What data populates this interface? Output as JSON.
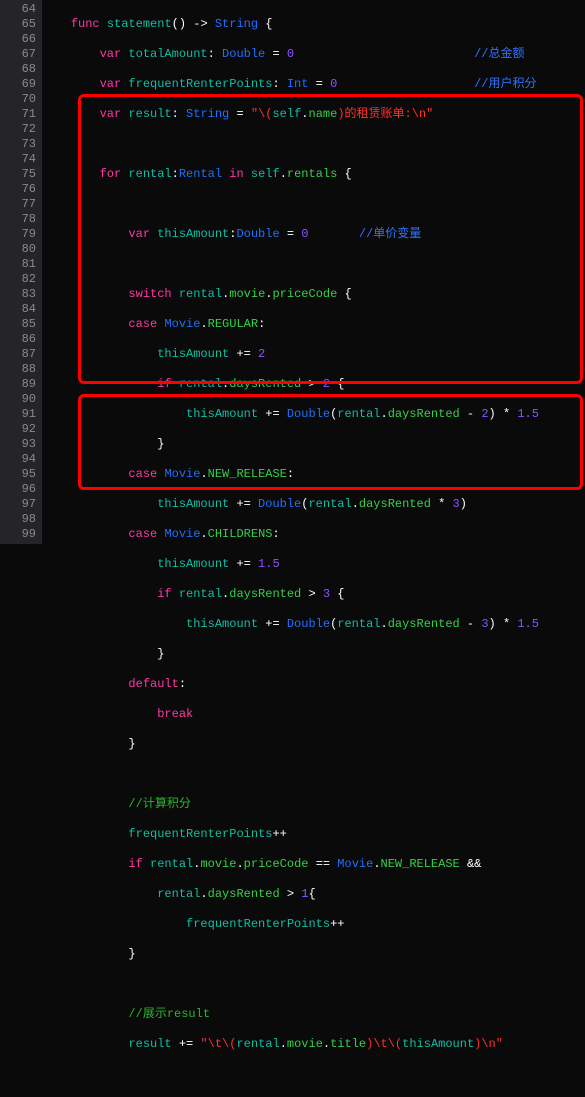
{
  "gutter": {
    "start": 64,
    "end": 99
  },
  "c64": {
    "func": "func",
    "name": "statement",
    "arrow": "->",
    "ret": "String",
    "brace": "{"
  },
  "c65": {
    "var": "var",
    "n": "totalAmount",
    "t": "Double",
    "eq": "=",
    "v": "0",
    "cmt": "//总金额"
  },
  "c66": {
    "var": "var",
    "n": "frequentRenterPoints",
    "t": "Int",
    "eq": "=",
    "v": "0",
    "cmt": "//用户积分"
  },
  "c67": {
    "var": "var",
    "n": "result",
    "t": "String",
    "eq": "=",
    "s1": "\"\\(",
    "sf": "self",
    "dot": ".",
    "nm": "name",
    "s2": ")的租赁账单:\\n\""
  },
  "c69": {
    "for": "for",
    "rv": "rental",
    "colon": ":",
    "t": "Rental",
    "in": "in",
    "sf": "self",
    "dot": ".",
    "rs": "rentals",
    "brace": "{"
  },
  "c71": {
    "var": "var",
    "n": "thisAmount",
    "t": "Double",
    "eq": "=",
    "v": "0",
    "cmt": "//单价变量"
  },
  "c73": {
    "sw": "switch",
    "rv": "rental",
    "d1": ".",
    "mv": "movie",
    "d2": ".",
    "pc": "priceCode",
    "brace": "{"
  },
  "c74": {
    "case": "case",
    "M": "Movie",
    "dot": ".",
    "k": "REGULAR",
    "colon": ":"
  },
  "c75": {
    "ta": "thisAmount",
    "op": "+=",
    "v": "2"
  },
  "c76": {
    "if": "if",
    "rv": "rental",
    "dot": ".",
    "dr": "daysRented",
    "gt": ">",
    "v": "2",
    "brace": "{"
  },
  "c77": {
    "ta": "thisAmount",
    "op": "+=",
    "D": "Double",
    "lp": "(",
    "rv": "rental",
    "dot": ".",
    "dr": "daysRented",
    "minus": "-",
    "v": "2",
    "rp": ")",
    "mul": "*",
    "f": "1.5"
  },
  "c78": {
    "close": "}"
  },
  "c79": {
    "case": "case",
    "M": "Movie",
    "dot": ".",
    "k": "NEW_RELEASE",
    "colon": ":"
  },
  "c80": {
    "ta": "thisAmount",
    "op": "+=",
    "D": "Double",
    "lp": "(",
    "rv": "rental",
    "dot": ".",
    "dr": "daysRented",
    "mul": "*",
    "v": "3",
    "rp": ")"
  },
  "c81": {
    "case": "case",
    "M": "Movie",
    "dot": ".",
    "k": "CHILDRENS",
    "colon": ":"
  },
  "c82": {
    "ta": "thisAmount",
    "op": "+=",
    "v": "1.5"
  },
  "c83": {
    "if": "if",
    "rv": "rental",
    "dot": ".",
    "dr": "daysRented",
    "gt": ">",
    "v": "3",
    "brace": "{"
  },
  "c84": {
    "ta": "thisAmount",
    "op": "+=",
    "D": "Double",
    "lp": "(",
    "rv": "rental",
    "dot": ".",
    "dr": "daysRented",
    "minus": "-",
    "v": "3",
    "rp": ")",
    "mul": "*",
    "f": "1.5"
  },
  "c85": {
    "close": "}"
  },
  "c86": {
    "def": "default",
    "colon": ":"
  },
  "c87": {
    "break": "break"
  },
  "c88": {
    "close": "}"
  },
  "c90": {
    "cmt": "//计算积分"
  },
  "c91": {
    "frp": "frequentRenterPoints",
    "pp": "++"
  },
  "c92": {
    "if": "if",
    "rv": "rental",
    "d1": ".",
    "mv": "movie",
    "d2": ".",
    "pc": "priceCode",
    "eq": "==",
    "M": "Movie",
    "d3": ".",
    "nr": "NEW_RELEASE",
    "and": "&&"
  },
  "c93": {
    "rv": "rental",
    "dot": ".",
    "dr": "daysRented",
    "gt": ">",
    "v": "1",
    "brace": "{"
  },
  "c94": {
    "frp": "frequentRenterPoints",
    "pp": "++"
  },
  "c95": {
    "close": "}"
  },
  "c97": {
    "cmt": "//展示result"
  },
  "c98": {
    "res": "result",
    "op": "+=",
    "s1": "\"\\t\\(",
    "rv": "rental",
    "d1": ".",
    "mv": "movie",
    "d2": ".",
    "ti": "title",
    "s2": ")\\t\\(",
    "ta": "thisAmount",
    "s3": ")\\n\""
  }
}
